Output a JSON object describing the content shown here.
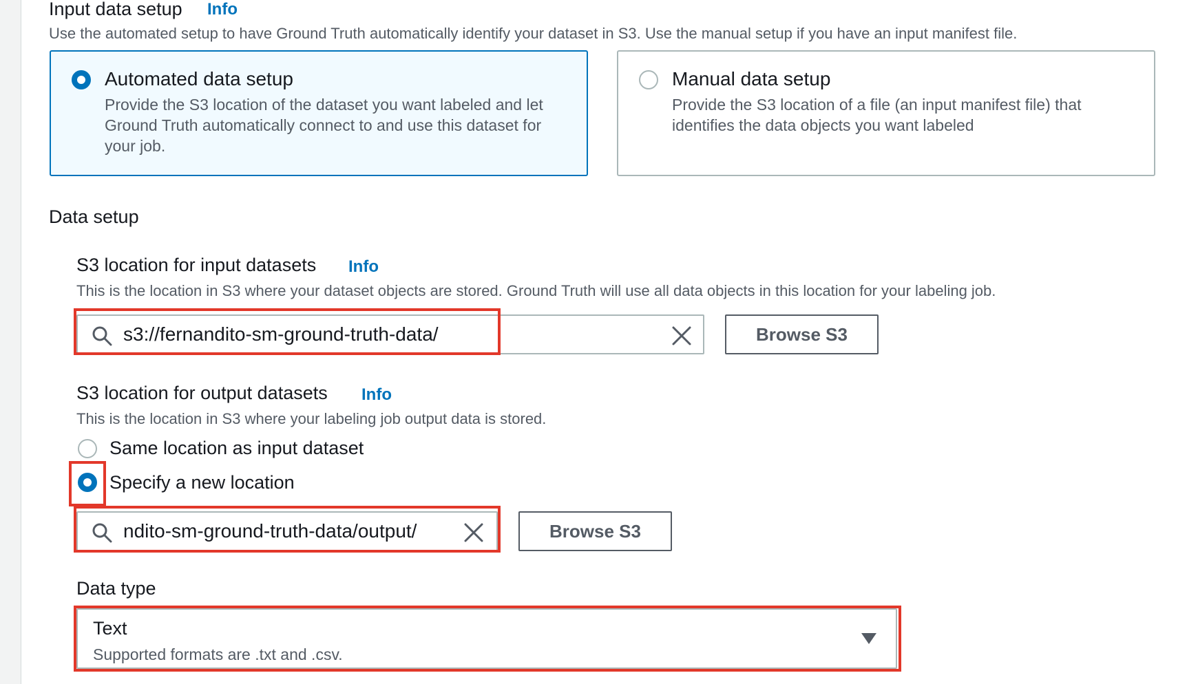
{
  "input_setup": {
    "title": "Input data setup",
    "info": "Info",
    "description": "Use the automated setup to have Ground Truth automatically identify your dataset in S3. Use the manual setup if you have an input manifest file.",
    "options": [
      {
        "title": "Automated data setup",
        "description": "Provide the S3 location of the dataset you want labeled and let Ground Truth automatically connect to and use this dataset for your job.",
        "selected": true
      },
      {
        "title": "Manual data setup",
        "description": "Provide the S3 location of a file (an input manifest file) that identifies the data objects you want labeled",
        "selected": false
      }
    ]
  },
  "data_setup": {
    "title": "Data setup",
    "input_location": {
      "label": "S3 location for input datasets",
      "info": "Info",
      "description": "This is the location in S3 where your dataset objects are stored. Ground Truth will use all data objects in this location for your labeling job.",
      "value": "s3://fernandito-sm-ground-truth-data/",
      "browse_label": "Browse S3"
    },
    "output_location": {
      "label": "S3 location for output datasets",
      "info": "Info",
      "description": "This is the location in S3 where your labeling job output data is stored.",
      "radio_same": "Same location as input dataset",
      "radio_new": "Specify a new location",
      "value": "ndito-sm-ground-truth-data/output/",
      "browse_label": "Browse S3"
    },
    "data_type": {
      "label": "Data type",
      "selected": "Text",
      "description": "Supported formats are .txt and .csv."
    }
  },
  "colors": {
    "accent": "#0073bb",
    "highlight": "#e2382a",
    "selected_bg": "#f1faff"
  }
}
